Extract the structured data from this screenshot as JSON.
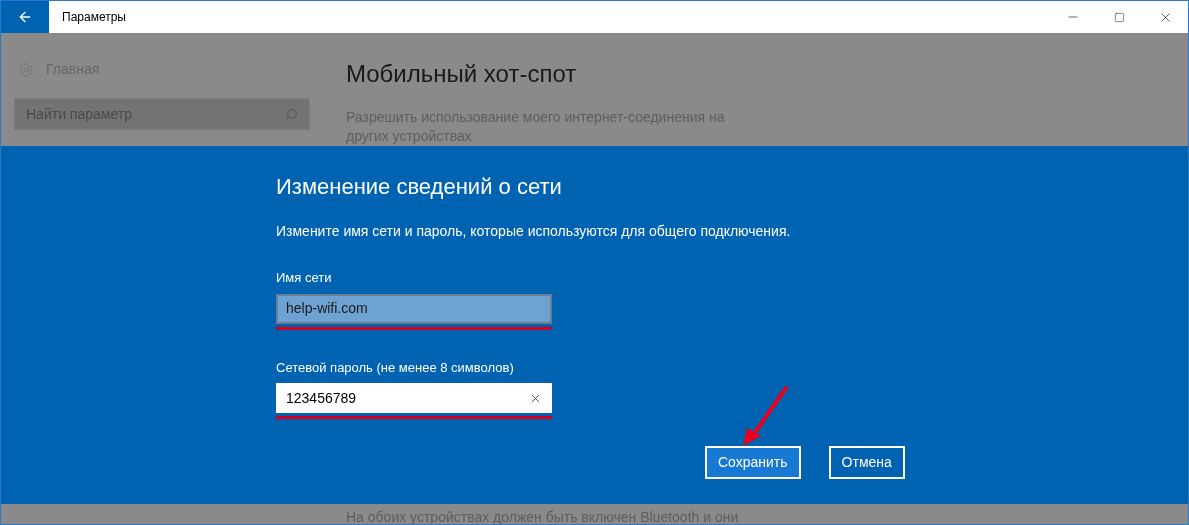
{
  "window": {
    "title": "Параметры"
  },
  "sidebar": {
    "home": "Главная",
    "search": {
      "placeholder": "Найти параметр"
    }
  },
  "page": {
    "title": "Мобильный хот-спот",
    "description": "Разрешить использование моего интернет-соединения на других устройствах",
    "footer_text": "На обоих устройствах должен быть включен Bluetooth и они"
  },
  "dialog": {
    "title": "Изменение сведений о сети",
    "instruction": "Измените имя сети и пароль, которые используются для общего подключения.",
    "fields": [
      {
        "label": "Имя сети",
        "value": "help-wifi.com",
        "focused": false,
        "clear_button": false
      },
      {
        "label": "Сетевой пароль (не менее 8 символов)",
        "value": "123456789",
        "focused": true,
        "clear_button": true
      }
    ],
    "buttons": [
      {
        "label": "Сохранить",
        "primary": true
      },
      {
        "label": "Отмена",
        "primary": false
      }
    ]
  }
}
